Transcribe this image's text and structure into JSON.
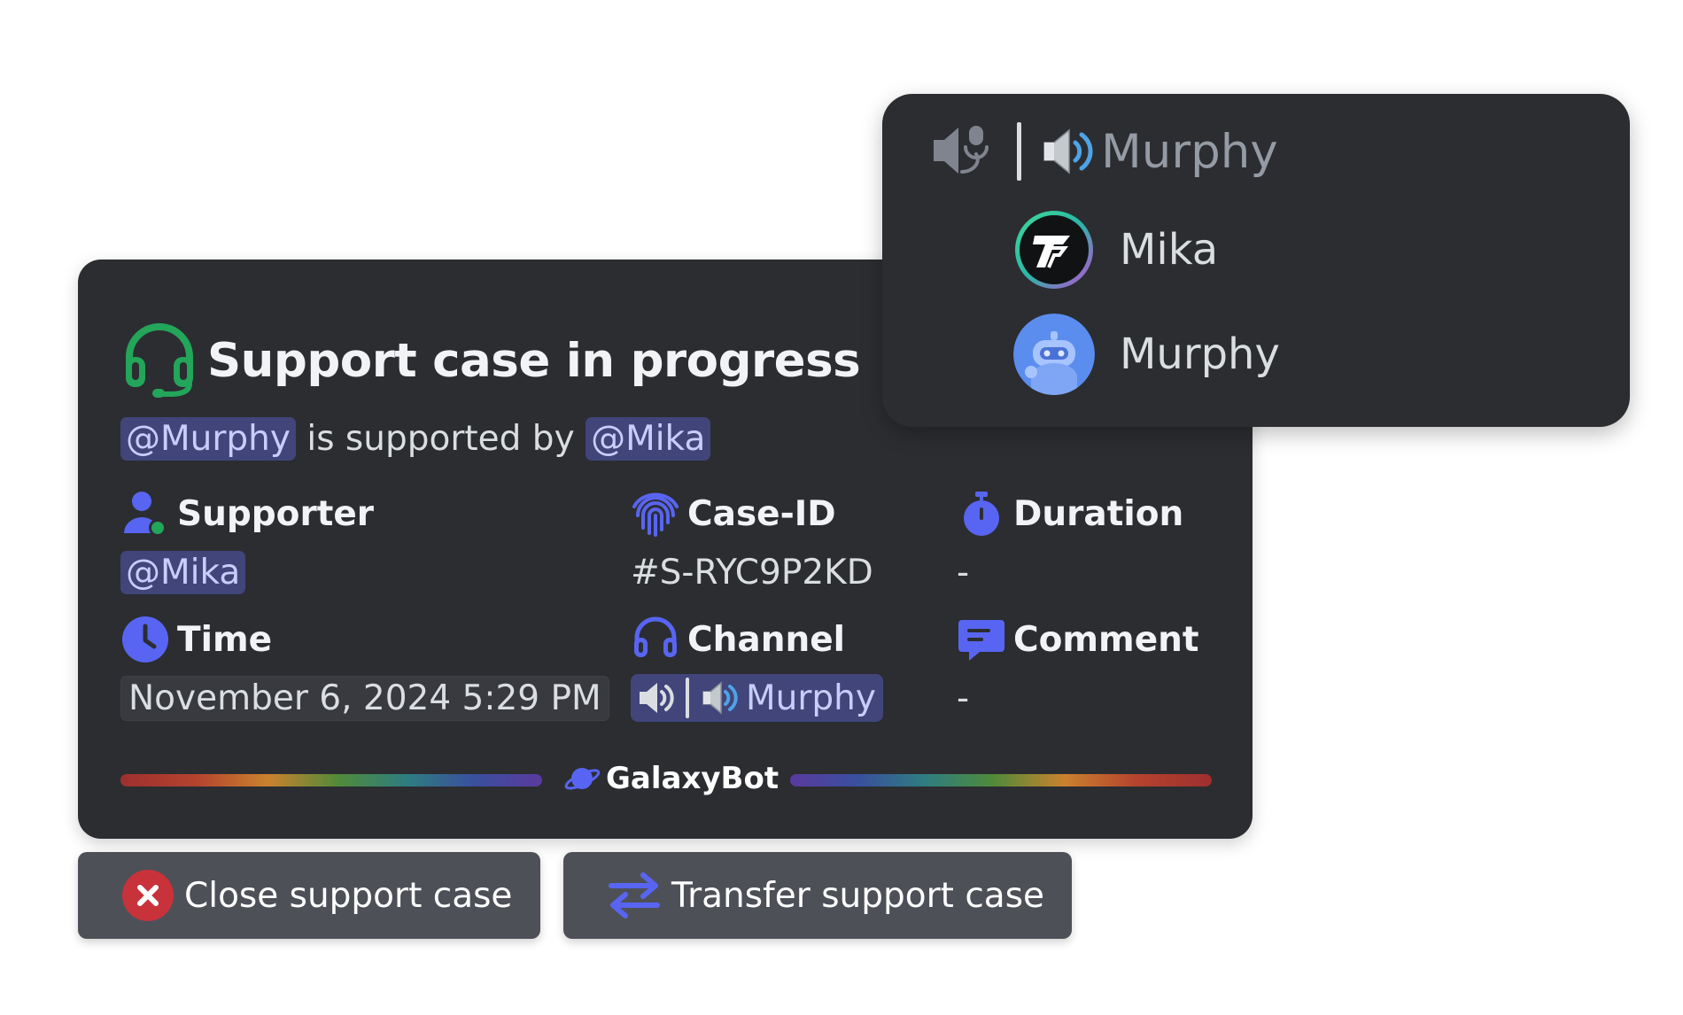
{
  "embed": {
    "title": "Support case in progress",
    "description": {
      "mention_user": "@Murphy",
      "connector": "is supported by",
      "mention_supporter": "@Mika"
    },
    "fields": {
      "supporter": {
        "name": "Supporter",
        "value": "@Mika"
      },
      "case_id": {
        "name": "Case-ID",
        "value": "#S-RYC9P2KD"
      },
      "duration": {
        "name": "Duration",
        "value": "-"
      },
      "time": {
        "name": "Time",
        "value": "November 6, 2024 5:29 PM"
      },
      "channel": {
        "name": "Channel",
        "value": "Murphy"
      },
      "comment": {
        "name": "Comment",
        "value": "-"
      }
    },
    "footer": {
      "brand": "GalaxyBot"
    }
  },
  "buttons": {
    "close": {
      "label": "Close support case",
      "icon": "close-circle-icon"
    },
    "transfer": {
      "label": "Transfer support case",
      "icon": "transfer-arrows-icon"
    }
  },
  "voice_popup": {
    "channel_name": "Murphy",
    "members": [
      {
        "name": "Mika",
        "avatar": "logo-avatar"
      },
      {
        "name": "Murphy",
        "avatar": "robot-avatar"
      }
    ]
  },
  "colors": {
    "embed_bg": "#2b2d31",
    "mention_bg": "#41457a",
    "mention_text": "#c9cdfb",
    "accent_green": "#23a55a",
    "accent_blurple": "#5865f2",
    "danger": "#da373c",
    "button_bg": "#4e5058"
  }
}
